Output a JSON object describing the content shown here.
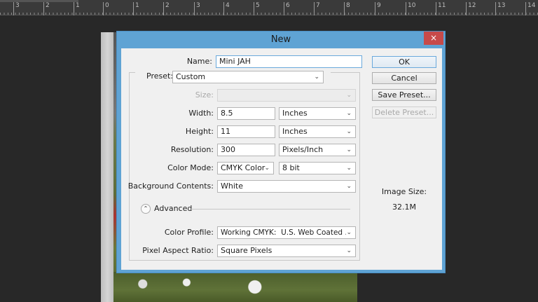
{
  "ruler": {
    "labels": [
      "3",
      "2",
      "1",
      "0",
      "1",
      "2",
      "3",
      "4",
      "5",
      "6",
      "7",
      "8",
      "9",
      "10",
      "11",
      "12",
      "13",
      "14"
    ]
  },
  "dialog": {
    "title": "New",
    "close_icon": "×",
    "name_label": "Name:",
    "name_value": "Mini JAH",
    "preset_label": "Preset:",
    "preset_value": "Custom",
    "size_label": "Size:",
    "size_value": "",
    "width_label": "Width:",
    "width_value": "8.5",
    "width_unit": "Inches",
    "height_label": "Height:",
    "height_value": "11",
    "height_unit": "Inches",
    "resolution_label": "Resolution:",
    "resolution_value": "300",
    "resolution_unit": "Pixels/Inch",
    "color_mode_label": "Color Mode:",
    "color_mode_value": "CMYK Color",
    "bit_depth": "8 bit",
    "background_label": "Background Contents:",
    "background_value": "White",
    "advanced_label": "Advanced",
    "color_profile_label": "Color Profile:",
    "color_profile_value": "Working CMYK:  U.S. Web Coated ...",
    "pixel_aspect_label": "Pixel Aspect Ratio:",
    "pixel_aspect_value": "Square Pixels",
    "buttons": {
      "ok": "OK",
      "cancel": "Cancel",
      "save_preset": "Save Preset...",
      "delete_preset": "Delete Preset..."
    },
    "image_size_label": "Image Size:",
    "image_size_value": "32.1M"
  },
  "colors": {
    "titlebar": "#5fa3d4",
    "close": "#c74a4a",
    "dialog_bg": "#f0f0f0",
    "workspace": "#282828"
  }
}
